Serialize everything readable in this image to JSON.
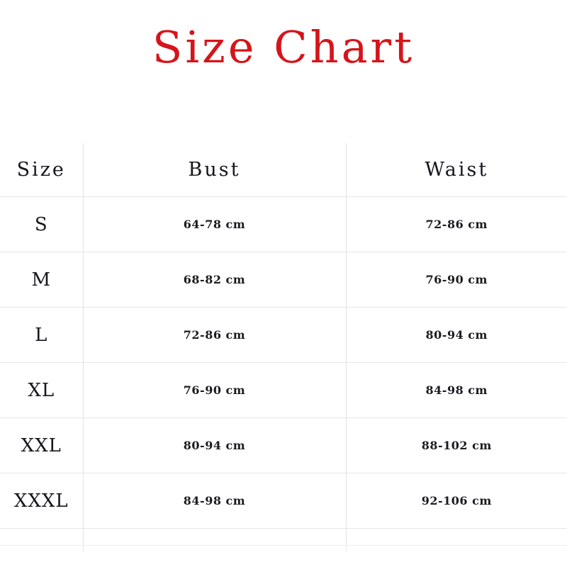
{
  "title": "Size Chart",
  "colors": {
    "title": "#d4151b",
    "text": "#16161b",
    "gridline": "#e5e5e5",
    "background": "#ffffff"
  },
  "table": {
    "columns": [
      {
        "key": "size",
        "label": "Size"
      },
      {
        "key": "bust",
        "label": "Bust"
      },
      {
        "key": "waist",
        "label": "Waist"
      }
    ],
    "rows": [
      {
        "size": "S",
        "bust": "64-78 cm",
        "waist": "72-86 cm"
      },
      {
        "size": "M",
        "bust": "68-82 cm",
        "waist": "76-90 cm"
      },
      {
        "size": "L",
        "bust": "72-86 cm",
        "waist": "80-94 cm"
      },
      {
        "size": "XL",
        "bust": "76-90 cm",
        "waist": "84-98 cm"
      },
      {
        "size": "XXL",
        "bust": "80-94 cm",
        "waist": "88-102 cm"
      },
      {
        "size": "XXXL",
        "bust": "84-98 cm",
        "waist": "92-106 cm"
      }
    ],
    "empty_trailing_row": {
      "size": "",
      "bust": "",
      "waist": ""
    }
  }
}
